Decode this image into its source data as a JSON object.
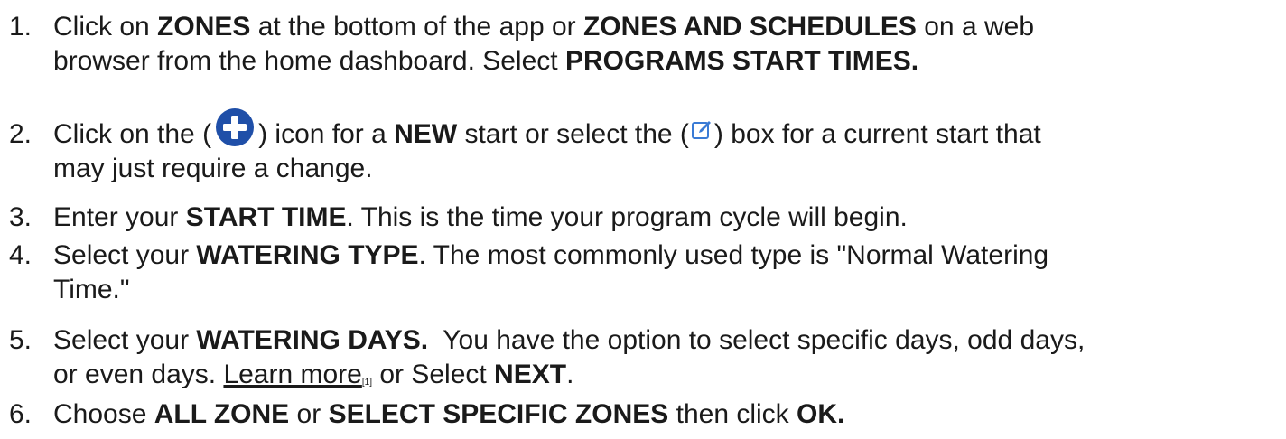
{
  "steps": [
    {
      "number": "1.",
      "line1": {
        "a": "Click on ",
        "b1": "ZONES",
        "c": " at the bottom of the app or ",
        "b2": "ZONES AND SCHEDULES",
        "d": " on a web"
      },
      "line2": {
        "a": "browser from the home dashboard. Select ",
        "b1": "PROGRAMS START TIMES."
      }
    },
    {
      "number": "2.",
      "line1": {
        "a": "Click on the (",
        "icon1": "plus-circle-icon",
        "b": ") icon for a ",
        "b1": "NEW",
        "c": " start or select the (",
        "icon2": "edit-box-icon",
        "d": ") box for a current start that"
      },
      "line2": {
        "a": "may just require a change."
      }
    },
    {
      "number": "3.",
      "line1": {
        "a": "Enter your ",
        "b1": "START TIME",
        "c": ". This is the time your program cycle will begin."
      }
    },
    {
      "number": "4.",
      "line1": {
        "a": "Select your ",
        "b1": "WATERING TYPE",
        "c": ". The most commonly used type is \"Normal Watering"
      },
      "line2": {
        "a": "Time.\""
      }
    },
    {
      "number": "5.",
      "line1": {
        "a": "Select your ",
        "b1": "WATERING DAYS.",
        "c": "  You have the option to select specific days, odd days,"
      },
      "line2": {
        "a": "or even days. ",
        "link": "Learn more",
        "ref": "[1]",
        "b": " or Select ",
        "b1": "NEXT",
        "c": "."
      }
    },
    {
      "number": "6.",
      "line1": {
        "a": "Choose ",
        "b1": "ALL ZONE",
        "c": " or ",
        "b2": "SELECT SPECIFIC ZONES",
        "d": " then click ",
        "b3": "OK."
      }
    }
  ],
  "colors": {
    "text": "#1a1a1a",
    "plus_icon": "#1f4fa8",
    "edit_icon": "#3a7bd5"
  }
}
